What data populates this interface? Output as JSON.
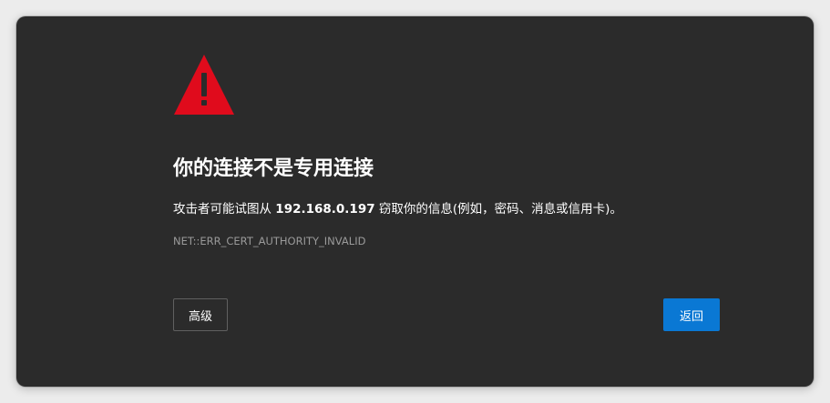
{
  "colors": {
    "background": "#2b2b2b",
    "warning_red": "#e00b1c",
    "primary_button": "#0a78d4",
    "muted_text": "#9a9a9a"
  },
  "icon": {
    "name": "warning-triangle-icon"
  },
  "page": {
    "heading": "你的连接不是专用连接",
    "message_before": "攻击者可能试图从 ",
    "message_host": "192.168.0.197",
    "message_after": " 窃取你的信息(例如，密码、消息或信用卡)。",
    "error_code": "NET::ERR_CERT_AUTHORITY_INVALID"
  },
  "buttons": {
    "advanced_label": "高级",
    "back_label": "返回"
  }
}
